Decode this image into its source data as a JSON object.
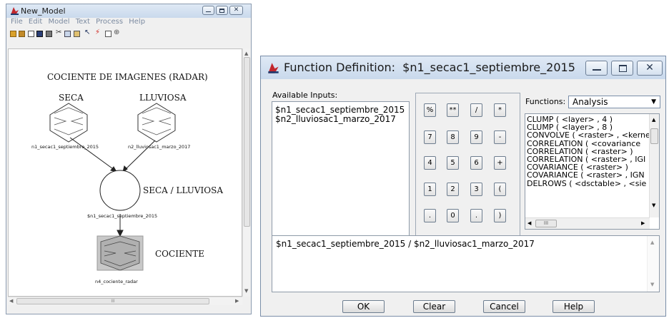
{
  "model_window": {
    "title": "New_Model",
    "menu": [
      "File",
      "Edit",
      "Model",
      "Text",
      "Process",
      "Help"
    ],
    "toolbar_icons": [
      "open-folder-icon",
      "open-icon",
      "new-icon",
      "save-icon",
      "print-icon",
      "cut-icon",
      "copy-icon",
      "paste-icon",
      "pointer-icon",
      "lightning-icon",
      "fit-icon",
      "zoom-icon"
    ],
    "canvas": {
      "title": "COCIENTE DE IMAGENES (RADAR)",
      "input1_label": "SECA",
      "input1_file": "n1_secac1_septiembre_2015",
      "input2_label": "LLUVIOSA",
      "input2_file": "n2_lluviosac1_marzo_2017",
      "function_label": "SECA / LLUVIOSA",
      "function_caption": "$n1_secac1_septiembre_2015",
      "output_label": "COCIENTE",
      "output_file": "n4_cociente_radar"
    },
    "hscroll_thumb": "III"
  },
  "function_dialog": {
    "title": "Function Definition:  $n1_secac1_septiembre_2015",
    "available_inputs_label": "Available Inputs:",
    "available_inputs": [
      "$n1_secac1_septiembre_2015",
      "$n2_lluviosac1_marzo_2017"
    ],
    "keypad": [
      "%",
      "**",
      "/",
      "*",
      "7",
      "8",
      "9",
      "-",
      "4",
      "5",
      "6",
      "+",
      "1",
      "2",
      "3",
      "(",
      ".",
      "0",
      ".",
      ")"
    ],
    "functions_label": "Functions:",
    "functions_category": "Analysis",
    "functions_list": [
      "CLUMP ( <layer> , 4 )",
      "CLUMP ( <layer> , 8 )",
      "CONVOLVE ( <raster> , <kerne",
      "CORRELATION ( <covariance",
      "CORRELATION ( <raster> )",
      "CORRELATION ( <raster> , IGI",
      "COVARIANCE ( <raster> )",
      "COVARIANCE ( <raster> , IGN",
      "DELROWS ( <dsctable> , <sie"
    ],
    "list_hscroll_thumb": "III",
    "expression": "$n1_secac1_septiembre_2015 / $n2_lluviosac1_marzo_2017",
    "buttons": {
      "ok": "OK",
      "clear": "Clear",
      "cancel": "Cancel",
      "help": "Help"
    }
  }
}
